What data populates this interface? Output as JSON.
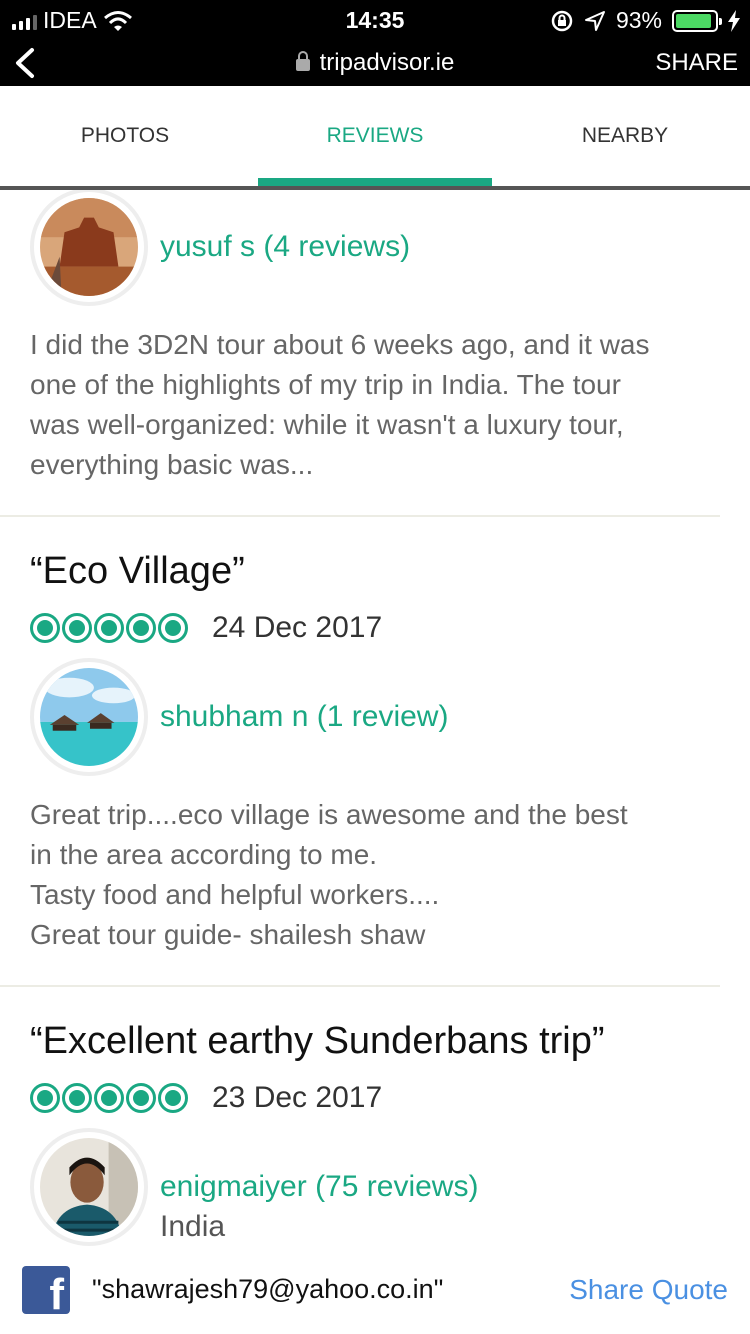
{
  "status_bar": {
    "carrier": "IDEA",
    "time": "14:35",
    "battery_percent": "93%",
    "battery_level": 0.93,
    "icons": [
      "signal-icon",
      "wifi-icon",
      "rotation-lock-icon",
      "location-arrow-icon",
      "battery-icon",
      "charging-icon"
    ]
  },
  "nav": {
    "url": "tripadvisor.ie",
    "share_label": "SHARE"
  },
  "tabs": [
    {
      "label": "PHOTOS",
      "active": false
    },
    {
      "label": "REVIEWS",
      "active": true
    },
    {
      "label": "NEARBY",
      "active": false
    }
  ],
  "reviews": [
    {
      "user": "yusuf s (4 reviews)",
      "text_lines": [
        "I did the 3D2N tour about 6 weeks ago, and it was",
        "one of the highlights of my trip in India. The tour",
        "was well-organized: while it wasn't a luxury tour,",
        "everything basic was..."
      ]
    },
    {
      "title": "“Eco Village”",
      "rating": 5,
      "date": "24 Dec 2017",
      "user": "shubham n (1 review)",
      "text_lines": [
        "Great trip....eco village is awesome and the best",
        "in the area according to me.",
        "Tasty food and helpful workers....",
        "Great tour guide- shailesh shaw"
      ]
    },
    {
      "title": "“Excellent earthy Sunderbans trip”",
      "rating": 5,
      "date": "23 Dec 2017",
      "user": "enigmaiyer (75 reviews)",
      "location": "India"
    }
  ],
  "share_bar": {
    "email": "\"shawrajesh79@yahoo.co.in\"",
    "share_quote_label": "Share Quote"
  },
  "colors": {
    "accent": "#1aa883",
    "link_blue": "#4a90e2",
    "facebook": "#3b5998"
  }
}
